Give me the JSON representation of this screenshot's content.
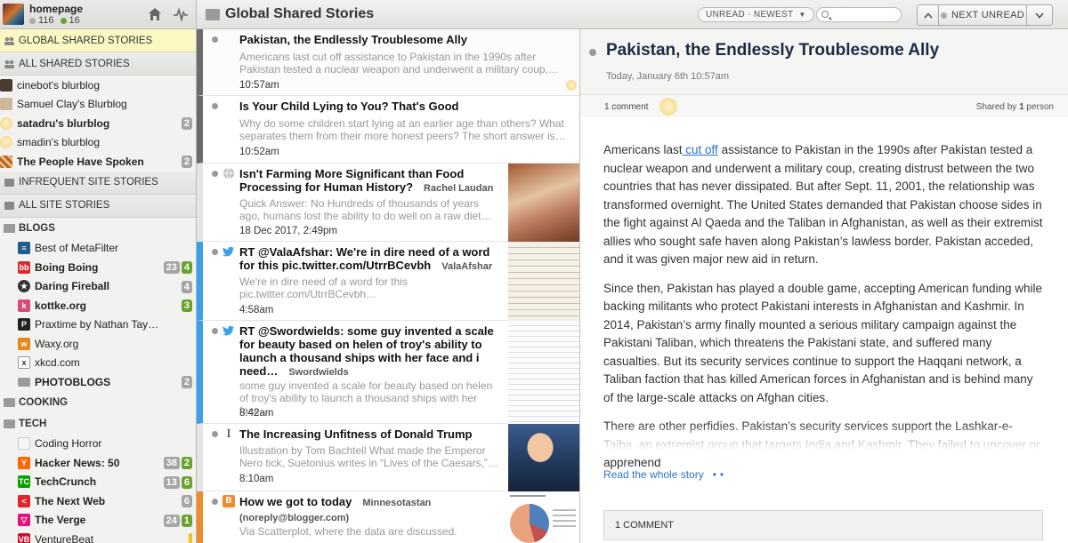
{
  "user": {
    "name": "homepage",
    "unread_count": "116",
    "new_count": "16"
  },
  "sidebar": {
    "top_folders": [
      {
        "label": "GLOBAL SHARED STORIES"
      },
      {
        "label": "ALL SHARED STORIES"
      }
    ],
    "blurblogs": [
      {
        "title": "cinebot's blurblog",
        "unread": ""
      },
      {
        "title": "Samuel Clay's Blurblog",
        "unread": ""
      },
      {
        "title": "satadru's blurblog",
        "unread": "2"
      },
      {
        "title": "smadin's blurblog",
        "unread": ""
      },
      {
        "title": "The People Have Spoken",
        "unread": "2"
      }
    ],
    "mid_folders": [
      {
        "label": "INFREQUENT SITE STORIES"
      },
      {
        "label": "ALL SITE STORIES"
      }
    ],
    "blogs_label": "BLOGS",
    "blogs": [
      {
        "title": "Best of MetaFilter",
        "unread": "",
        "new": ""
      },
      {
        "title": "Boing Boing",
        "unread": "23",
        "new": "4"
      },
      {
        "title": "Daring Fireball",
        "unread": "4",
        "new": ""
      },
      {
        "title": "kottke.org",
        "unread": "",
        "new": "3"
      },
      {
        "title": "Praxtime by Nathan Tay…",
        "unread": "",
        "new": ""
      },
      {
        "title": "Waxy.org",
        "unread": "",
        "new": ""
      },
      {
        "title": "xkcd.com",
        "unread": "",
        "new": ""
      }
    ],
    "photoblogs": {
      "title": "PHOTOBLOGS",
      "unread": "2"
    },
    "cooking_label": "COOKING",
    "tech_label": "TECH",
    "tech": [
      {
        "title": "Coding Horror",
        "unread": "",
        "new": ""
      },
      {
        "title": "Hacker News: 50",
        "unread": "38",
        "new": "2"
      },
      {
        "title": "TechCrunch",
        "unread": "13",
        "new": "6"
      },
      {
        "title": "The Next Web",
        "unread": "6",
        "new": ""
      },
      {
        "title": "The Verge",
        "unread": "24",
        "new": "1"
      },
      {
        "title": "VentureBeat",
        "unread": "",
        "new": ""
      }
    ]
  },
  "header": {
    "title": "Global Shared Stories",
    "view_select": "UNREAD · NEWEST",
    "next_unread": "NEXT UNREAD"
  },
  "stories": [
    {
      "title": "Pakistan, the Endlessly Troublesome Ally",
      "author": "",
      "snippet": "Americans last cut off assistance to Pakistan in the 1990s after Pakistan tested a nuclear weapon and underwent a military coup,…",
      "date": "10:57am"
    },
    {
      "title": "Is Your Child Lying to You? That's Good",
      "author": "",
      "snippet": "Why do some children start lying at an earlier age than others? What separates them from their more honest peers? The short answer is…",
      "date": "10:52am"
    },
    {
      "title": "Isn't Farming More Significant than Food Processing for Human History?",
      "author": "Rachel Laudan",
      "snippet": "Quick Answer: No Hundreds of thousands of years ago, humans lost the ability to do well on a raw diet…",
      "date": "18 Dec 2017, 2:49pm"
    },
    {
      "title": "RT @ValaAfshar: We're in dire need of a word for this pic.twitter.com/UtrrBCevbh",
      "author": "ValaAfshar",
      "snippet": "We're in dire need of a word for this pic.twitter.com/UtrrBCevbh…",
      "date": "4:58am"
    },
    {
      "title": "RT @Swordwields: some guy invented a scale for beauty based on helen of troy's ability to launch a thousand ships with her face and i need…",
      "author": "Swordwields",
      "snippet": "some guy invented a scale for beauty based on helen of troy's ability to launch a thousand ships with her face…",
      "date": "8:42am"
    },
    {
      "title": "The Increasing Unfitness of Donald Trump",
      "author": "",
      "snippet": "Illustration by Tom Bachtell What made the Emperor Nero tick, Suetonius writes in “Lives of the Caesars,”…",
      "date": "8:10am"
    },
    {
      "title": "How we got to today",
      "author": "Minnesotastan",
      "author2": "(noreply@blogger.com)",
      "snippet": "Via Scatterplot, where the data are discussed.",
      "date": ""
    }
  ],
  "reader": {
    "title": "Pakistan, the Endlessly Troublesome Ally",
    "date": "Today, January 6th 10:57am",
    "comment_count": "1 comment",
    "shared_by_prefix": "Shared by ",
    "shared_by_count": "1",
    "shared_by_suffix": " person",
    "p1_pre": "Americans last",
    "p1_link": " cut off",
    "p1_post": " assistance to Pakistan in the 1990s after Pakistan tested a nuclear weapon and underwent a military coup, creating distrust between the two countries that has never dissipated. But after Sept. 11, 2001, the relationship was transformed overnight. The United States demanded that Pakistan choose sides in the fight against Al Qaeda and the Taliban in Afghanistan, as well as their extremist allies who sought safe haven along Pakistan’s lawless border. Pakistan acceded, and it was given major new aid in return.",
    "p2": "Since then, Pakistan has played a double game, accepting American funding while backing militants who protect Pakistani interests in Afghanistan and Kashmir. In 2014, Pakistan’s army finally mounted a serious military campaign against the Pakistani Taliban, which threatens the Pakistani state, and suffered many casualties. But its security services continue to support the Haqqani network, a Taliban faction that has killed American forces in Afghanistan and is behind many of the large-scale attacks on Afghan cities.",
    "p3": "There are other perfidies. Pakistan’s security services support the Lashkar-e-Taiba, an extremist group that targets India and Kashmir. They failed to uncover or apprehend",
    "read_whole": "Read the whole story",
    "comments_footer": "1 COMMENT"
  },
  "colors": {
    "selected_folder": "#fbf8c4",
    "unread_badge": "#a5a5a5",
    "new_badge": "#6aa22e",
    "link": "#2c73c8",
    "twitter_bar": "#3aa0e8",
    "blogger_bar": "#f08a2c"
  }
}
